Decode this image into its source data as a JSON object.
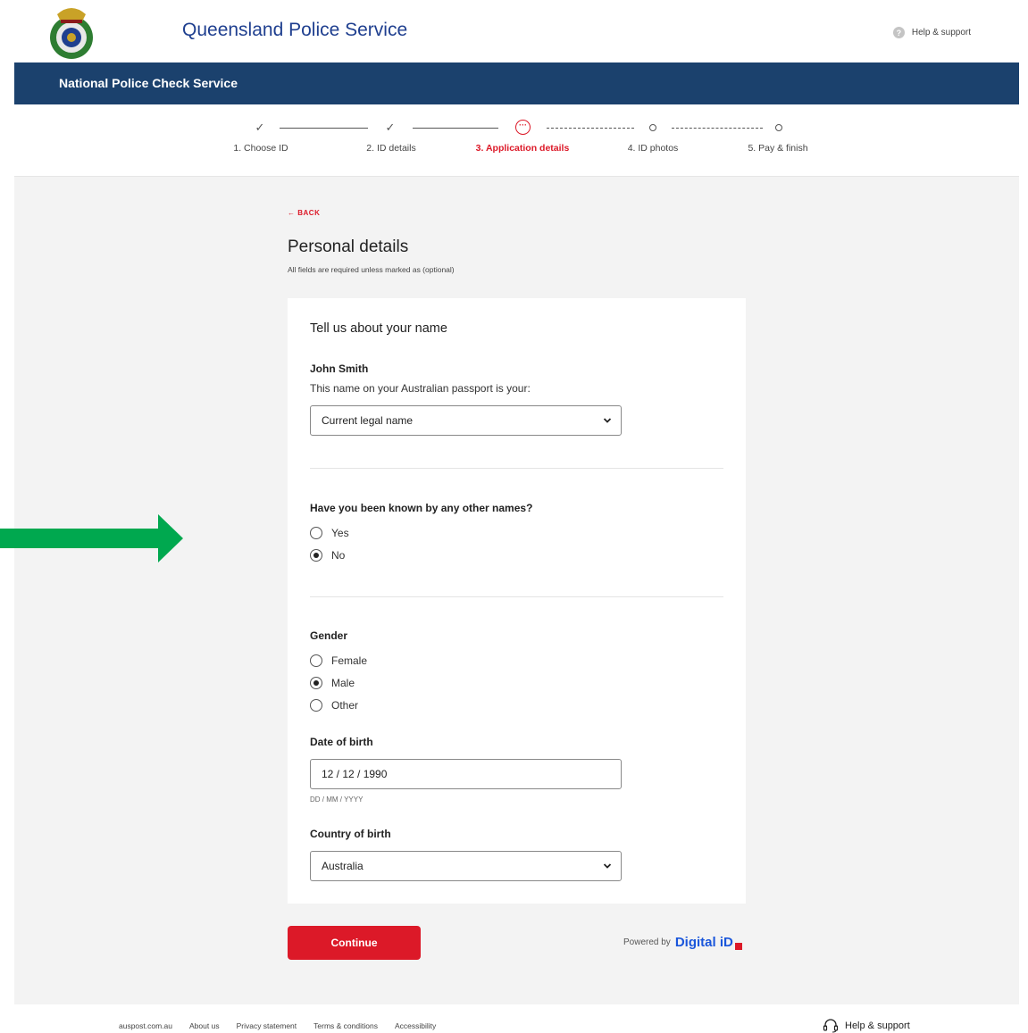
{
  "header": {
    "org_name": "Queensland Police Service",
    "help_label": "Help & support"
  },
  "nav": {
    "title": "National Police Check Service"
  },
  "steps": [
    {
      "label": "1. Choose ID",
      "state": "done"
    },
    {
      "label": "2. ID details",
      "state": "done"
    },
    {
      "label": "3. Application details",
      "state": "active"
    },
    {
      "label": "4. ID photos",
      "state": "pending"
    },
    {
      "label": "5. Pay & finish",
      "state": "pending"
    }
  ],
  "page": {
    "back_label": "BACK",
    "title": "Personal details",
    "subtitle": "All fields are required unless marked as (optional)"
  },
  "form": {
    "name_section_title": "Tell us about your name",
    "person_name": "John Smith",
    "name_question": "This name on your Australian passport is your:",
    "name_type_value": "Current legal name",
    "other_names_question": "Have you been known by any other names?",
    "other_names_options": [
      "Yes",
      "No"
    ],
    "other_names_selected": "No",
    "gender_label": "Gender",
    "gender_options": [
      "Female",
      "Male",
      "Other"
    ],
    "gender_selected": "Male",
    "dob_label": "Date of birth",
    "dob_value": "12 / 12 / 1990",
    "dob_hint": "DD / MM / YYYY",
    "country_label": "Country of birth",
    "country_value": "Australia"
  },
  "actions": {
    "continue_label": "Continue",
    "powered_by": "Powered by",
    "powered_brand": "Digital iD"
  },
  "footer": {
    "links": [
      "auspost.com.au",
      "About us",
      "Privacy statement",
      "Terms & conditions",
      "Accessibility"
    ],
    "help_label": "Help & support"
  },
  "colors": {
    "brand_red": "#dc1928",
    "nav_blue": "#1b416d",
    "org_blue": "#1f3f8f",
    "arrow_green": "#00a84f"
  },
  "icons": {
    "check": "check-icon",
    "more": "more-icon",
    "chevron": "chevron-down-icon",
    "back": "arrow-left-icon",
    "help": "question-icon",
    "headset": "headset-icon"
  }
}
